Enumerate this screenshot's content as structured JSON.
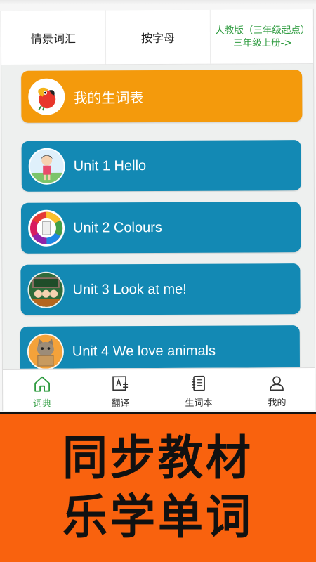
{
  "tabs": [
    {
      "label": "情景词汇"
    },
    {
      "label": "按字母"
    },
    {
      "label": "人教版（三年级起点）",
      "sub": "三年级上册->"
    }
  ],
  "list": {
    "items": [
      {
        "label": "我的生词表",
        "color": "#f49a0c",
        "icon": "parrot-avatar-icon"
      },
      {
        "label": "Unit 1 Hello",
        "color": "#1389b4",
        "icon": "girl-cartoon-icon"
      },
      {
        "label": "Unit 2 Colours",
        "color": "#1389b4",
        "icon": "color-wheel-icon"
      },
      {
        "label": "Unit 3 Look at me!",
        "color": "#1389b4",
        "icon": "classroom-kids-icon"
      },
      {
        "label": "Unit 4 We love animals",
        "color": "#1389b4",
        "icon": "cat-icon"
      }
    ]
  },
  "bottom_nav": {
    "items": [
      {
        "label": "词典",
        "icon": "home-icon",
        "active": true
      },
      {
        "label": "翻译",
        "icon": "translate-icon"
      },
      {
        "label": "生词本",
        "icon": "notebook-icon"
      },
      {
        "label": "我的",
        "icon": "user-icon"
      }
    ]
  },
  "banner": {
    "line1": "同步教材",
    "line2": "乐学单词"
  },
  "colors": {
    "accent_green": "#2e9b3f",
    "card_orange": "#f49a0c",
    "card_blue": "#1389b4",
    "banner_orange": "#f9620e"
  }
}
